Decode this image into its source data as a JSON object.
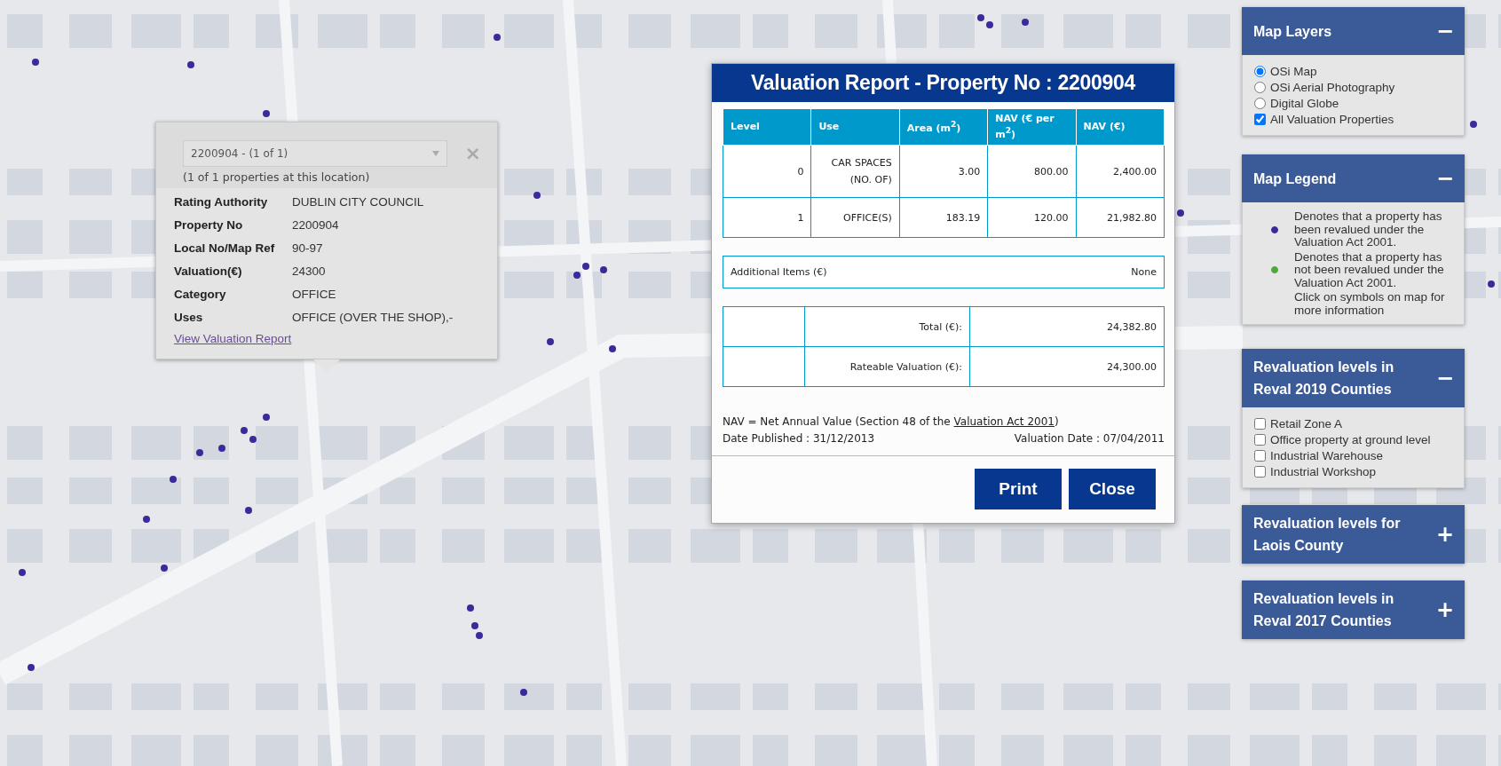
{
  "popup": {
    "select_value": "2200904 - (1 of 1)",
    "close": "×",
    "count_note": "(1 of 1 properties at this location)",
    "fields": [
      {
        "label": "Rating Authority",
        "value": "DUBLIN CITY COUNCIL"
      },
      {
        "label": "Property No",
        "value": "2200904"
      },
      {
        "label": "Local No/Map Ref",
        "value": "90-97"
      },
      {
        "label": "Valuation(€)",
        "value": "24300"
      },
      {
        "label": "Category",
        "value": "OFFICE"
      },
      {
        "label": "Uses",
        "value": "OFFICE (OVER THE SHOP),-"
      }
    ],
    "link": "View Valuation Report"
  },
  "report": {
    "title": "Valuation Report - Property No : 2200904",
    "columns": [
      "Level",
      "Use",
      "Area (m$^{2}$)",
      "NAV (€ per m$^{2}$)",
      "NAV (€)"
    ],
    "rows": [
      [
        "0",
        "CAR SPACES (NO. OF)",
        "3.00",
        "800.00",
        "2,400.00"
      ],
      [
        "1",
        "OFFICE(S)",
        "183.19",
        "120.00",
        "21,982.80"
      ]
    ],
    "additional": {
      "label": "Additional Items (€)",
      "value": "None"
    },
    "totals": [
      {
        "label": "Total (€):",
        "value": "24,382.80"
      },
      {
        "label": "Rateable Valuation (€):",
        "value": "24,300.00"
      }
    ],
    "note": "NAV = Net Annual Value (Section 48 of the ",
    "note_link": "Valuation Act 2001",
    "note_end": ")",
    "date_published": "Date Published : 31/12/2013",
    "valuation_date": "Valuation Date : 07/04/2011",
    "buttons": [
      "Print",
      "Close"
    ]
  },
  "panels": [
    {
      "title": "Map Layers",
      "toggle": "−",
      "expanded": true,
      "items": [
        {
          "kind": "radio",
          "label": "OSi Map",
          "selected": true
        },
        {
          "kind": "radio",
          "label": "OSi Aerial Photography",
          "selected": false
        },
        {
          "kind": "radio",
          "label": "Digital Globe",
          "selected": false
        },
        {
          "kind": "checkbox",
          "label": "All Valuation Properties",
          "checked": true
        }
      ]
    },
    {
      "title": "Map Legend",
      "toggle": "−",
      "expanded": true,
      "legend": [
        {
          "color": "#3b2a9a",
          "text": "Denotes that a property has been revalued under the Valuation Act 2001."
        },
        {
          "color": "#4fa83a",
          "text": "Denotes that a property has not been revalued under the Valuation Act 2001."
        },
        {
          "text": "Click on symbols on map for more information"
        }
      ]
    },
    {
      "title": "Revaluation levels in Reval 2019 Counties",
      "toggle": "−",
      "expanded": true,
      "items": [
        {
          "kind": "checkbox",
          "label": "Retail Zone A",
          "checked": false
        },
        {
          "kind": "checkbox",
          "label": "Office property at ground level",
          "checked": false
        },
        {
          "kind": "checkbox",
          "label": "Industrial Warehouse",
          "checked": false
        },
        {
          "kind": "checkbox",
          "label": "Industrial Workshop",
          "checked": false
        }
      ]
    },
    {
      "title": "Revaluation levels for Laois County",
      "toggle": "+",
      "expanded": false
    },
    {
      "title": "Revaluation levels in Reval 2017 Counties",
      "toggle": "+",
      "expanded": false
    }
  ]
}
